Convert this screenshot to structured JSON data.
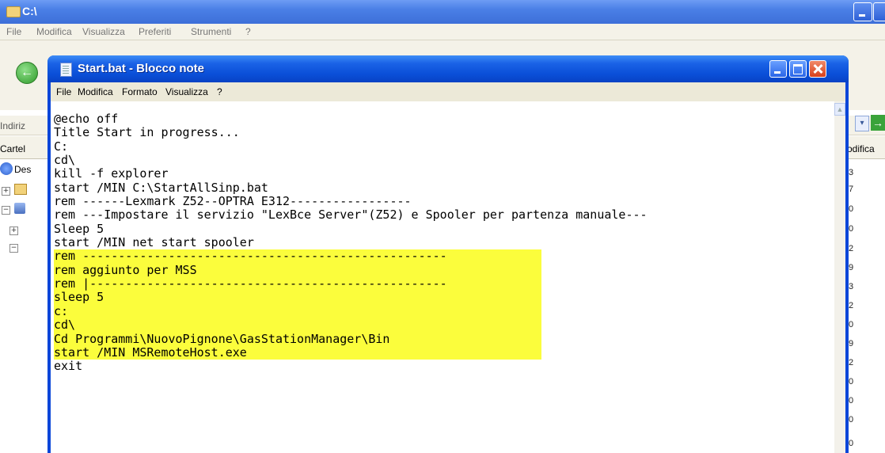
{
  "explorer": {
    "title": "C:\\",
    "menu": [
      "File",
      "Modifica",
      "Visualizza",
      "Preferiti",
      "Strumenti",
      "?"
    ],
    "address_label": "Indiriz",
    "folders_label": "Cartel",
    "tree_desktop": "Des",
    "edit_label": "odifica",
    "right_column_values": [
      "3",
      "7",
      "0",
      "0",
      "2",
      "9",
      "3",
      "2",
      "0",
      "9",
      "2",
      "0",
      "0",
      "0",
      "0"
    ]
  },
  "notepad": {
    "title": "Start.bat - Blocco note",
    "menu": [
      "File",
      "Modifica",
      "Formato",
      "Visualizza",
      "?"
    ],
    "highlight_color": "#fbfd3c",
    "lines": [
      {
        "text": "@echo off",
        "hl": false
      },
      {
        "text": "Title Start in progress...",
        "hl": false
      },
      {
        "text": "C:",
        "hl": false
      },
      {
        "text": "cd\\",
        "hl": false
      },
      {
        "text": "kill -f explorer",
        "hl": false
      },
      {
        "text": "start /MIN C:\\StartAllSinp.bat",
        "hl": false
      },
      {
        "text": "rem ------Lexmark Z52--OPTRA E312-----------------",
        "hl": false
      },
      {
        "text": "rem ---Impostare il servizio \"LexBce Server\"(Z52) e Spooler per partenza manuale---",
        "hl": false
      },
      {
        "text": "Sleep 5",
        "hl": false
      },
      {
        "text": "start /MIN net start spooler",
        "hl": false
      },
      {
        "text": "rem ---------------------------------------------------",
        "hl": true
      },
      {
        "text": "rem aggiunto per MSS",
        "hl": true
      },
      {
        "text": "rem |--------------------------------------------------",
        "hl": true
      },
      {
        "text": "sleep 5",
        "hl": true
      },
      {
        "text": "c:",
        "hl": true
      },
      {
        "text": "cd\\",
        "hl": true
      },
      {
        "text": "Cd Programmi\\NuovoPignone\\GasStationManager\\Bin",
        "hl": true
      },
      {
        "text": "start /MIN MSRemoteHost.exe",
        "hl": true
      },
      {
        "text": "exit",
        "hl": false
      }
    ]
  }
}
